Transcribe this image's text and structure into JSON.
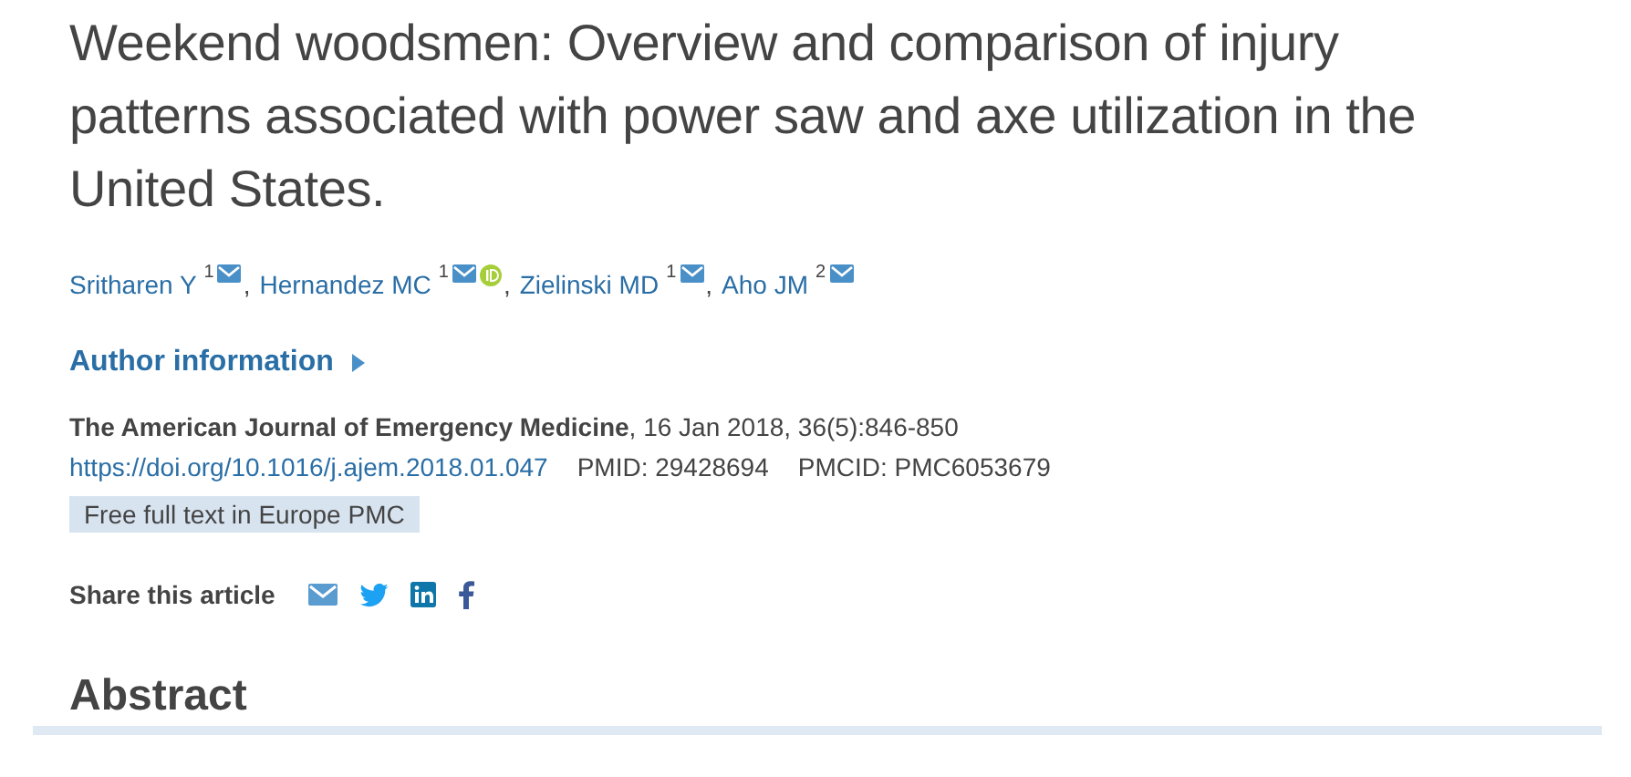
{
  "title": "Weekend woodsmen: Overview and comparison of injury patterns associated with power saw and axe utilization in the United States.",
  "authors": [
    {
      "name": "Sritharen Y",
      "affiliation": "1",
      "orcid": false,
      "separator": ","
    },
    {
      "name": "Hernandez MC",
      "affiliation": "1",
      "orcid": true,
      "separator": ","
    },
    {
      "name": "Zielinski MD",
      "affiliation": "1",
      "orcid": false,
      "separator": ","
    },
    {
      "name": "Aho JM",
      "affiliation": "2",
      "orcid": false
    }
  ],
  "author_information": {
    "label": "Author information",
    "expanded": false
  },
  "citation": {
    "journal": "The American Journal of Emergency Medicine",
    "details": ", 16 Jan 2018, 36(5):846-850"
  },
  "doi": "https://doi.org/10.1016/j.ajem.2018.01.047",
  "pmid": "PMID: 29428694",
  "pmcid": "PMCID: PMC6053679",
  "badge": "Free full text in Europe PMC",
  "share": {
    "label": "Share this article",
    "services": [
      {
        "kind": "email"
      },
      {
        "kind": "twitter"
      },
      {
        "kind": "linkedin"
      },
      {
        "kind": "facebook"
      }
    ]
  },
  "section_heading": "Abstract"
}
